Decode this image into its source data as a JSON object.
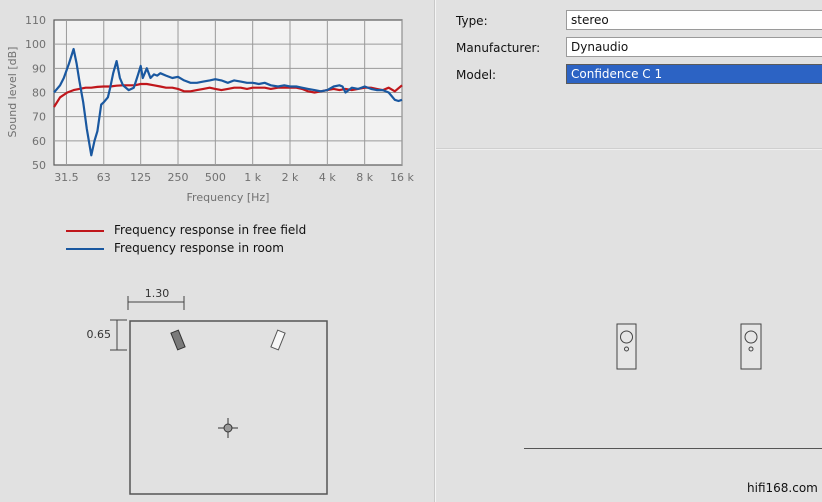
{
  "form": {
    "type_label": "Type:",
    "type_value": "stereo",
    "manufacturer_label": "Manufacturer:",
    "manufacturer_value": "Dynaudio",
    "model_label": "Model:",
    "model_value": "Confidence C 1"
  },
  "legend": {
    "free_field": "Frequency response in free field",
    "room": "Frequency response in room",
    "free_field_color": "#c0161b",
    "room_color": "#1a58a0"
  },
  "room": {
    "width_label": "1.30",
    "depth_label": "0.65"
  },
  "footer": {
    "brand": "hifi168.com"
  },
  "chart_data": {
    "type": "line",
    "xlabel": "Frequency [Hz]",
    "ylabel": "Sound level [dB]",
    "x_scale": "log",
    "xlim": [
      25,
      16000
    ],
    "ylim": [
      50,
      110
    ],
    "x_ticks": [
      31.5,
      63,
      125,
      250,
      500,
      1000,
      2000,
      4000,
      8000,
      16000
    ],
    "x_tick_labels": [
      "31.5",
      "63",
      "125",
      "250",
      "500",
      "1 k",
      "2 k",
      "4 k",
      "8 k",
      "16 k"
    ],
    "y_ticks": [
      50,
      60,
      70,
      80,
      90,
      100,
      110
    ],
    "grid": true,
    "legend_position": "below",
    "series": [
      {
        "name": "Frequency response in free field",
        "color": "#c0161b",
        "x": [
          25,
          28,
          32,
          36,
          40,
          45,
          50,
          56,
          63,
          71,
          80,
          90,
          100,
          112,
          125,
          140,
          160,
          180,
          200,
          225,
          250,
          280,
          315,
          355,
          400,
          450,
          500,
          560,
          630,
          710,
          800,
          900,
          1000,
          1120,
          1250,
          1400,
          1600,
          1800,
          2000,
          2250,
          2500,
          2800,
          3150,
          3550,
          4000,
          4500,
          5000,
          5600,
          6300,
          7100,
          8000,
          9000,
          10000,
          11200,
          12500,
          14000,
          16000
        ],
        "y": [
          74,
          78,
          80,
          81,
          81.5,
          82,
          82,
          82.3,
          82.5,
          82.5,
          82.8,
          83,
          83,
          83,
          83.5,
          83.5,
          83,
          82.5,
          82,
          82,
          81.5,
          80.5,
          80.5,
          81,
          81.5,
          82,
          81.5,
          81,
          81.5,
          82,
          82,
          81.5,
          82,
          82,
          82,
          81.5,
          82,
          82,
          82,
          82,
          81.5,
          80.5,
          80,
          80.5,
          81,
          81.5,
          81,
          81.5,
          81,
          81.5,
          82,
          82,
          81.5,
          81,
          82,
          80.5,
          83
        ]
      },
      {
        "name": "Frequency response in room",
        "color": "#1a58a0",
        "x": [
          25,
          28,
          30,
          33,
          36,
          38,
          40,
          43,
          46,
          50,
          53,
          56,
          60,
          63,
          68,
          71,
          75,
          80,
          85,
          90,
          100,
          110,
          115,
          120,
          125,
          130,
          140,
          150,
          160,
          170,
          180,
          200,
          225,
          250,
          280,
          315,
          355,
          400,
          450,
          500,
          560,
          630,
          710,
          800,
          900,
          1000,
          1120,
          1250,
          1400,
          1600,
          1800,
          2000,
          2250,
          2500,
          2800,
          3150,
          3550,
          4000,
          4500,
          5000,
          5300,
          5600,
          6300,
          7100,
          8000,
          9000,
          10000,
          11200,
          12500,
          14000,
          15000,
          16000
        ],
        "y": [
          80,
          83,
          86,
          92,
          98,
          92,
          85,
          76,
          65,
          54,
          60,
          64,
          75,
          76,
          78,
          82,
          88,
          93,
          86,
          83,
          81,
          82,
          85,
          88,
          91,
          86,
          90,
          86,
          87.5,
          87,
          88,
          87,
          86,
          86.5,
          85,
          84,
          84,
          84.5,
          85,
          85.5,
          85,
          84,
          85,
          84.5,
          84,
          84,
          83.5,
          84,
          83,
          82.5,
          83,
          82.5,
          82.5,
          82,
          81.5,
          81,
          80.5,
          81,
          82.5,
          83,
          82.5,
          80,
          82,
          81.5,
          82.5,
          81.5,
          81,
          81,
          80,
          77,
          76.5,
          77
        ]
      }
    ]
  }
}
